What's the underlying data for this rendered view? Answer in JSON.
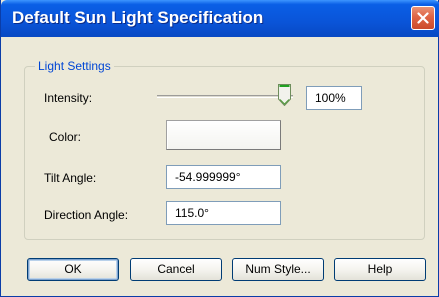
{
  "window": {
    "title": "Default Sun Light Specification"
  },
  "group": {
    "label": "Light Settings"
  },
  "intensity": {
    "label": "Intensity:",
    "value": "100%",
    "percent": 100
  },
  "color": {
    "label": "Color:",
    "swatch": "#ffffff"
  },
  "tilt": {
    "label": "Tilt Angle:",
    "value": "-54.999999°"
  },
  "direction": {
    "label": "Direction Angle:",
    "value": "115.0°"
  },
  "buttons": {
    "ok": "OK",
    "cancel": "Cancel",
    "num_style": "Num Style...",
    "help": "Help"
  },
  "colors": {
    "title_bar": "#0a54d8",
    "accent_blue": "#0046d5",
    "close": "#df6444"
  },
  "icons": {
    "close": "close-icon",
    "slider_thumb": "slider-thumb"
  }
}
